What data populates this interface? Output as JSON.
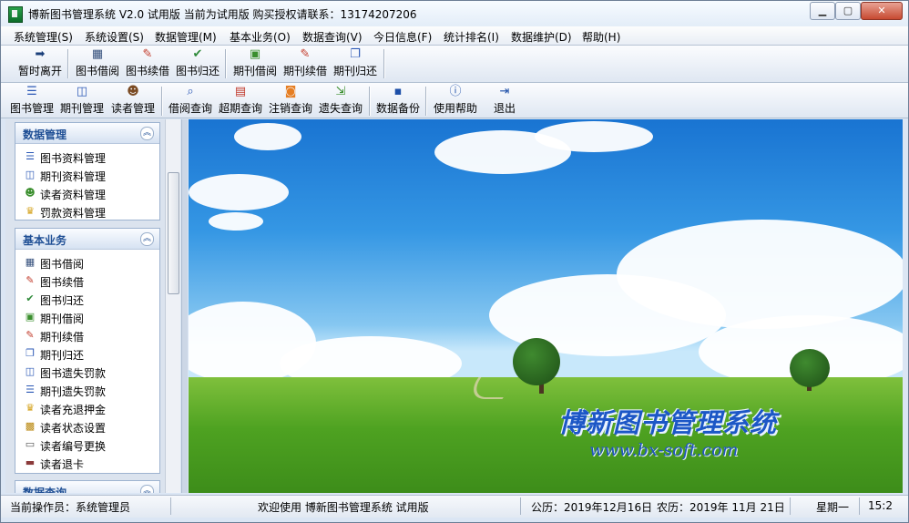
{
  "window": {
    "title": "博新图书管理系统 V2.0  试用版  当前为试用版  购买授权请联系：13174207206",
    "controls": {
      "minimize": "▁",
      "maximize": "▢",
      "close": "✕"
    }
  },
  "menubar": [
    "系统管理(S)",
    "系统设置(S)",
    "数据管理(M)",
    "基本业务(O)",
    "数据查询(V)",
    "今日信息(F)",
    "统计排名(I)",
    "数据维护(D)",
    "帮助(H)"
  ],
  "toolbar1": [
    {
      "label": "暂时离开",
      "icon": "door-arrow-icon"
    },
    {
      "label": "图书借阅",
      "icon": "grid-book-icon"
    },
    {
      "label": "图书续借",
      "icon": "notepad-pen-icon"
    },
    {
      "label": "图书归还",
      "icon": "return-check-icon"
    },
    {
      "label": "期刊借阅",
      "icon": "picture-icon"
    },
    {
      "label": "期刊续借",
      "icon": "notepad-pen-icon"
    },
    {
      "label": "期刊归还",
      "icon": "copy-pages-icon"
    }
  ],
  "toolbar2": [
    {
      "label": "图书管理",
      "icon": "book-list-icon"
    },
    {
      "label": "期刊管理",
      "icon": "open-book-icon"
    },
    {
      "label": "读者管理",
      "icon": "user-icon"
    },
    {
      "label": "借阅查询",
      "icon": "doc-search-icon"
    },
    {
      "label": "超期查询",
      "icon": "calendar-icon"
    },
    {
      "label": "注销查询",
      "icon": "rss-icon"
    },
    {
      "label": "遗失查询",
      "icon": "doc-arrow-icon"
    },
    {
      "label": "数据备份",
      "icon": "floppy-icon"
    },
    {
      "label": "使用帮助",
      "icon": "info-icon"
    },
    {
      "label": "退出",
      "icon": "exit-icon"
    }
  ],
  "sidebar": {
    "panels": [
      {
        "title": "数据管理",
        "items": [
          {
            "label": "图书资料管理",
            "icon": "book-list-icon"
          },
          {
            "label": "期刊资料管理",
            "icon": "open-book-icon"
          },
          {
            "label": "读者资料管理",
            "icon": "users-icon"
          },
          {
            "label": "罚款资料管理",
            "icon": "trophy-icon"
          }
        ]
      },
      {
        "title": "基本业务",
        "items": [
          {
            "label": "图书借阅",
            "icon": "grid-book-icon"
          },
          {
            "label": "图书续借",
            "icon": "notepad-pen-icon"
          },
          {
            "label": "图书归还",
            "icon": "return-check-icon"
          },
          {
            "label": "期刊借阅",
            "icon": "picture-icon"
          },
          {
            "label": "期刊续借",
            "icon": "notepad-pen-icon"
          },
          {
            "label": "期刊归还",
            "icon": "copy-pages-icon"
          },
          {
            "label": "图书遗失罚款",
            "icon": "open-book-icon"
          },
          {
            "label": "期刊遗失罚款",
            "icon": "book-list-icon"
          },
          {
            "label": "读者充退押金",
            "icon": "trophy-icon"
          },
          {
            "label": "读者状态设置",
            "icon": "lock-icon"
          },
          {
            "label": "读者编号更换",
            "icon": "id-card-icon"
          },
          {
            "label": "读者退卡",
            "icon": "card-icon"
          }
        ]
      },
      {
        "title": "数据查询",
        "items": []
      }
    ]
  },
  "banner": {
    "title": "博新图书管理系统",
    "url": "www.bx-soft.com"
  },
  "statusbar": {
    "operator": "当前操作员：系统管理员",
    "welcome": "欢迎使用  博新图书管理系统  试用版",
    "gregorian": "公历：2019年12月16日",
    "lunar": "农历：2019年 11月 21日",
    "weekday": "星期一",
    "time": "15:2"
  },
  "colors": {
    "panel_title": "#1f4f95",
    "brand_text": "#1c57c6",
    "close_button": "#c74a31"
  }
}
